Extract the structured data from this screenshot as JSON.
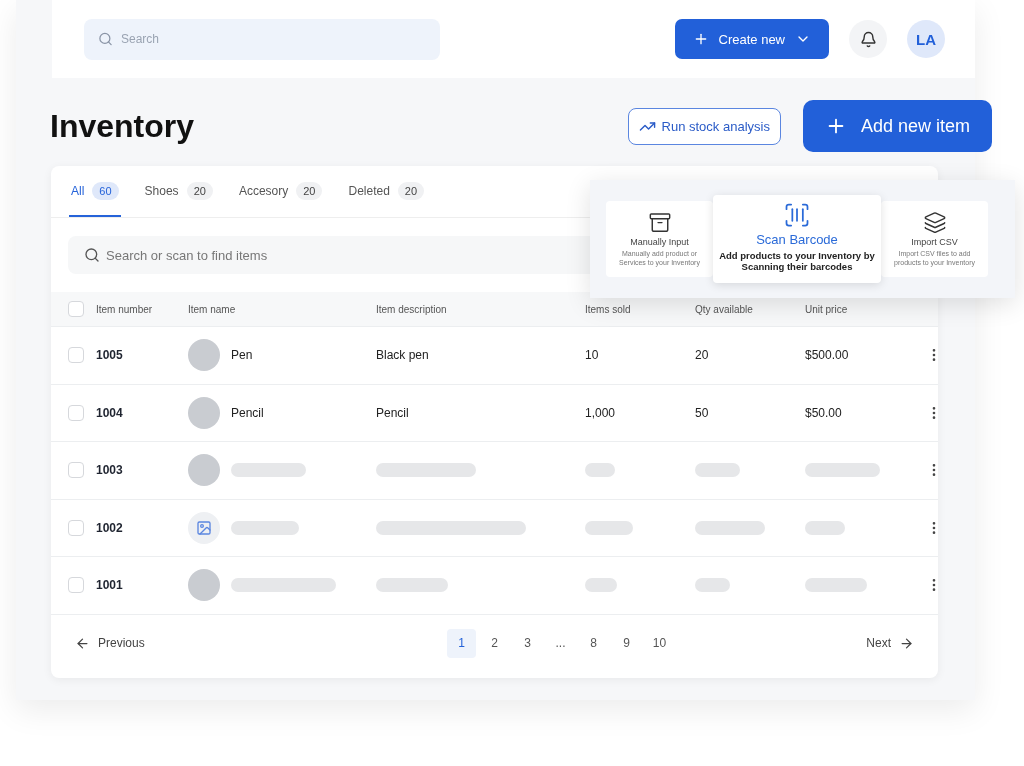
{
  "topbar": {
    "search_placeholder": "Search",
    "create_button": "Create new",
    "avatar": "LA"
  },
  "page": {
    "title": "Inventory",
    "analysis_button": "Run stock analysis",
    "add_button": "Add new item"
  },
  "tabs": [
    {
      "label": "All",
      "count": "60",
      "selected": true
    },
    {
      "label": "Shoes",
      "count": "20",
      "selected": false
    },
    {
      "label": "Accesory",
      "count": "20",
      "selected": false
    },
    {
      "label": "Deleted",
      "count": "20",
      "selected": false
    }
  ],
  "item_search": {
    "placeholder": "Search or scan to find items"
  },
  "add_menu": [
    {
      "title": "Manually Input",
      "text": "Manually add product or Services to your Inventory",
      "selected": false
    },
    {
      "title": "Scan Barcode",
      "text": "Add products to your Inventory by Scanning their barcodes",
      "selected": true
    },
    {
      "title": "Import CSV",
      "text": "Import CSV files to add products to your Inventory",
      "selected": false
    }
  ],
  "table": {
    "all_checked": false,
    "columns": [
      "Item number",
      "Item name",
      "Item description",
      "Items sold",
      "Qty available",
      "Unit price"
    ],
    "rows": [
      {
        "kind": "loaded",
        "number": "1005",
        "thumb": {
          "kind": "photo"
        },
        "name": "Pen",
        "description": "Black pen",
        "sold": "10",
        "qty": "20",
        "price": "$500.00",
        "checked": false
      },
      {
        "kind": "loaded",
        "number": "1004",
        "thumb": {
          "kind": "photo"
        },
        "name": "Pencil",
        "description": "Pencil",
        "sold": "1,000",
        "qty": "50",
        "price": "$50.00",
        "checked": false
      },
      {
        "kind": "loading",
        "number": "1003",
        "thumb": {
          "kind": "photo"
        },
        "checked": false
      },
      {
        "kind": "loading",
        "number": "1002",
        "thumb": {
          "kind": "placeholder"
        },
        "checked": false
      },
      {
        "kind": "loading",
        "number": "1001",
        "thumb": {
          "kind": "photo"
        },
        "checked": false
      }
    ]
  },
  "pagination": {
    "previous": "Previous",
    "next": "Next",
    "pages": [
      {
        "label": "1",
        "selected": true
      },
      {
        "label": "2",
        "selected": false
      },
      {
        "label": "3",
        "selected": false
      },
      {
        "label": "...",
        "selected": false
      },
      {
        "label": "8",
        "selected": false
      },
      {
        "label": "9",
        "selected": false
      },
      {
        "label": "10",
        "selected": false
      }
    ]
  }
}
